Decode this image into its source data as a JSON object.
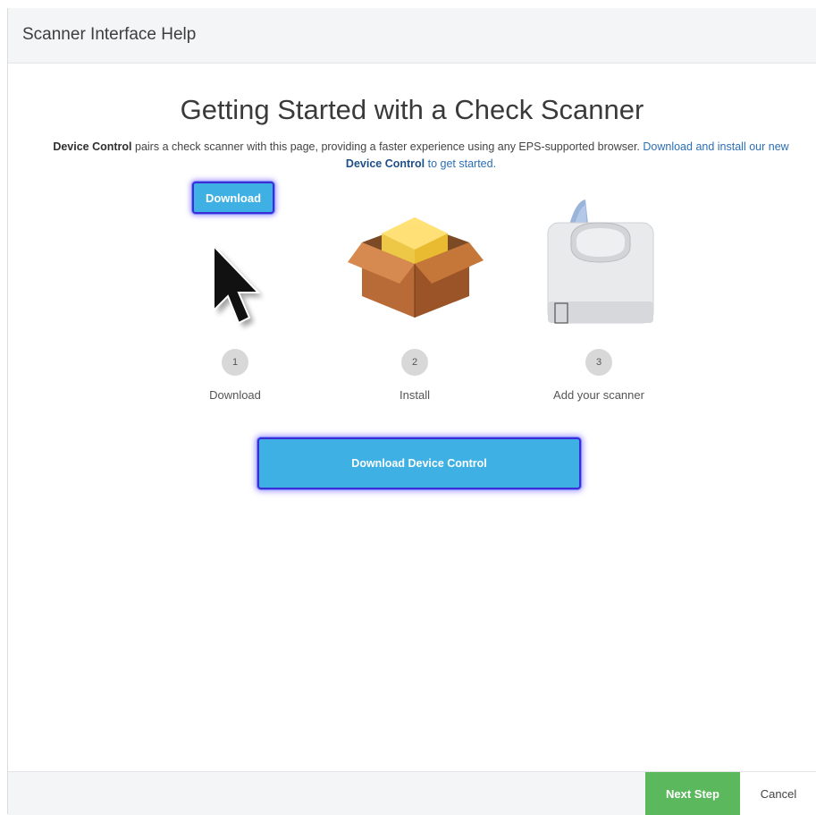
{
  "header": {
    "title": "Scanner Interface Help"
  },
  "main": {
    "title": "Getting Started with a Check Scanner",
    "description": {
      "lead_bold": "Device Control",
      "text": " pairs a check scanner with this page, providing a faster experience using any EPS-supported browser. ",
      "link_text_1": "Download and install our new ",
      "link_bold": "Device Control",
      "link_text_2": " to get started."
    },
    "download_button_label": "Download",
    "steps": [
      {
        "number": "1",
        "label": "Download",
        "icon": "cursor-arrow-icon"
      },
      {
        "number": "2",
        "label": "Install",
        "icon": "package-box-icon"
      },
      {
        "number": "3",
        "label": "Add your scanner",
        "icon": "check-scanner-icon"
      }
    ],
    "primary_button_label": "Download Device Control"
  },
  "footer": {
    "next_label": "Next Step",
    "cancel_label": "Cancel"
  },
  "colors": {
    "accent_blue": "#3fb0e4",
    "focus_outline": "#3a2fd6",
    "next_green": "#5bb85d",
    "link_blue": "#2b6fb6"
  }
}
